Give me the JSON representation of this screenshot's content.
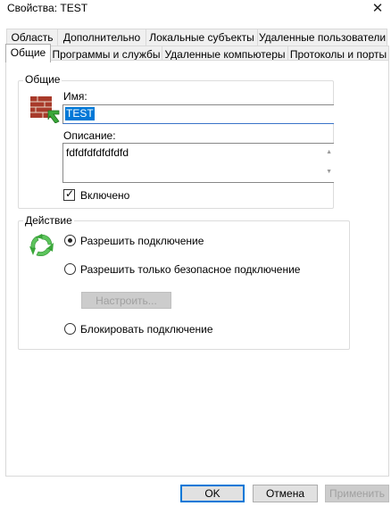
{
  "window": {
    "title": "Свойства: TEST",
    "close_glyph": "✕"
  },
  "tabs_row1": [
    "Область",
    "Дополнительно",
    "Локальные субъекты",
    "Удаленные пользователи"
  ],
  "tabs_row2": [
    "Общие",
    "Программы и службы",
    "Удаленные компьютеры",
    "Протоколы и порты"
  ],
  "active_tab": "Общие",
  "general": {
    "legend": "Общие",
    "icon": "firewall-rule-icon",
    "name_label": "Имя:",
    "name_value": "TEST",
    "description_label": "Описание:",
    "description_value": "fdfdfdfdfdfdfd",
    "enabled_label": "Включено",
    "enabled_checked": true
  },
  "action": {
    "legend": "Действие",
    "icon": "recycle-arrows-icon",
    "options": [
      {
        "label": "Разрешить подключение",
        "selected": true
      },
      {
        "label": "Разрешить только безопасное подключение",
        "selected": false
      },
      {
        "label": "Блокировать подключение",
        "selected": false
      }
    ],
    "configure_label": "Настроить..."
  },
  "footer": {
    "ok": "OK",
    "cancel": "Отмена",
    "apply": "Применить"
  },
  "colors": {
    "accent": "#0078d7",
    "brick": "#a83a2a",
    "green": "#3aa83a"
  }
}
